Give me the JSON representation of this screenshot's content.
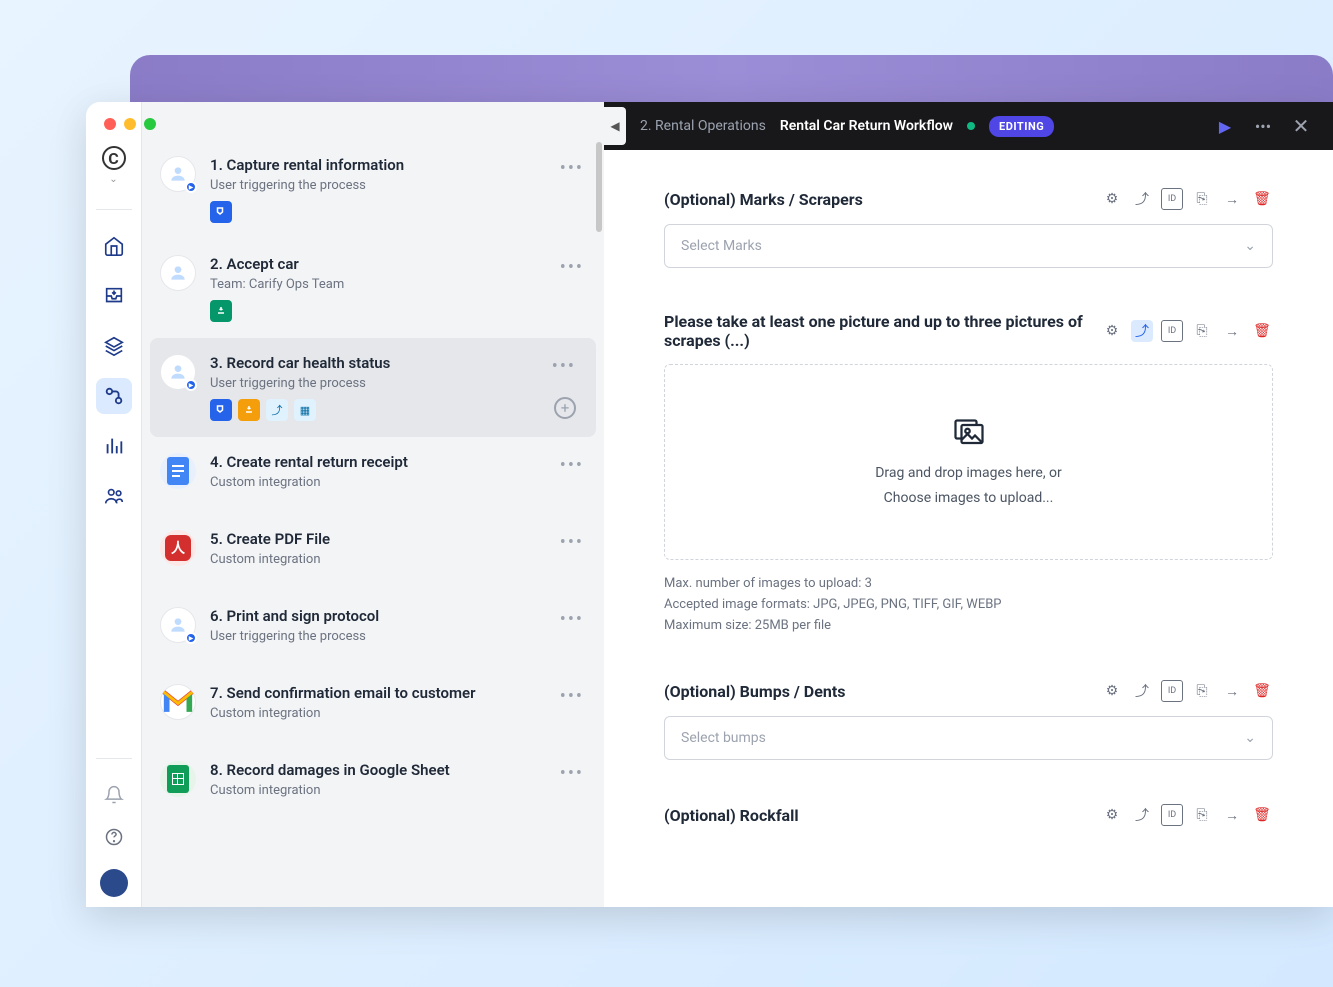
{
  "topbar": {
    "breadcrumb": "2. Rental Operations",
    "title": "Rental Car Return Workflow",
    "status_badge": "EDITING"
  },
  "steps": [
    {
      "title": "1. Capture rental information",
      "subtitle": "User triggering the process",
      "icon": "user",
      "badges": [
        "form-blue"
      ]
    },
    {
      "title": "2. Accept car",
      "subtitle": "Team: Carify Ops Team",
      "icon": "user",
      "badges": [
        "task-green"
      ]
    },
    {
      "title": "3. Record car health status",
      "subtitle": "User triggering the process",
      "icon": "user",
      "badges": [
        "form-blue",
        "task-orange",
        "share-light",
        "cal-light"
      ],
      "active": true,
      "add": true
    },
    {
      "title": "4. Create rental return receipt",
      "subtitle": "Custom integration",
      "icon": "gdoc"
    },
    {
      "title": "5. Create PDF File",
      "subtitle": "Custom integration",
      "icon": "pdf"
    },
    {
      "title": "6. Print and sign protocol",
      "subtitle": "User triggering the process",
      "icon": "user"
    },
    {
      "title": "7. Send confirmation email to customer",
      "subtitle": "Custom integration",
      "icon": "gmail"
    },
    {
      "title": "8. Record damages in Google Sheet",
      "subtitle": "Custom integration",
      "icon": "gsheet"
    }
  ],
  "form": {
    "section1": {
      "title": "(Optional) Marks / Scrapers",
      "placeholder": "Select Marks"
    },
    "section2": {
      "title": "Please take at least one picture and up to three pictures of scrapes (...)",
      "dropzone_line1": "Drag and drop images here, or",
      "dropzone_line2": "Choose images to upload...",
      "hint1": "Max. number of images to upload: 3",
      "hint2": "Accepted image formats: JPG, JPEG, PNG, TIFF, GIF, WEBP",
      "hint3": "Maximum size: 25MB per file"
    },
    "section3": {
      "title": "(Optional) Bumps / Dents",
      "placeholder": "Select bumps"
    },
    "section4": {
      "title": "(Optional) Rockfall"
    }
  }
}
